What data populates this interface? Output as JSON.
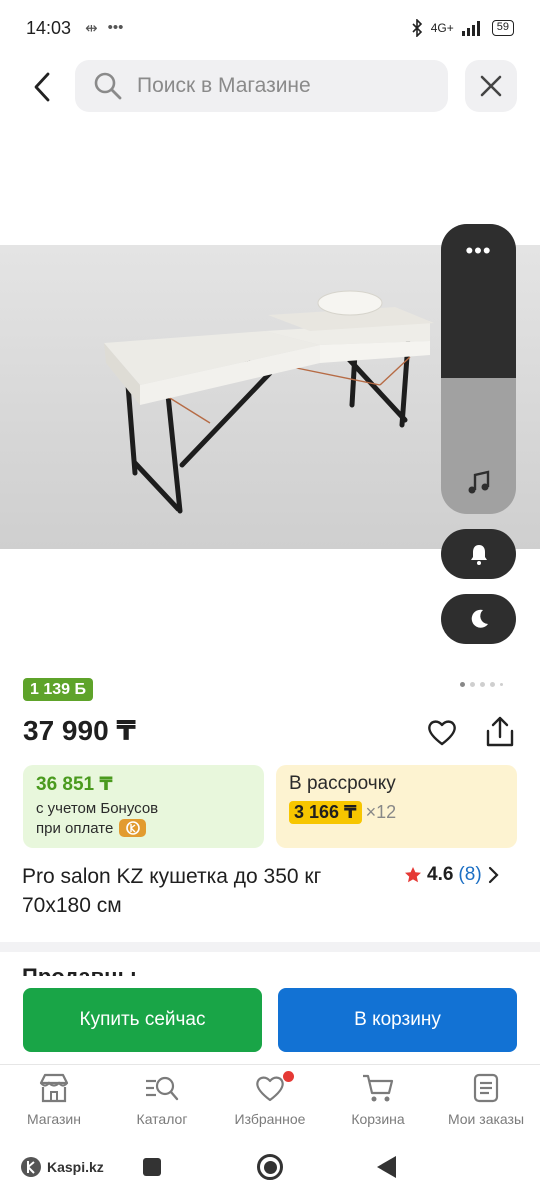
{
  "status": {
    "time": "14:03",
    "network": "4G+",
    "battery": "59"
  },
  "search": {
    "placeholder": "Поиск в Магазине"
  },
  "product": {
    "bonus_badge": "1 139 Б",
    "price": "37 990 ₸",
    "title": "Pro salon KZ кушетка до 350 кг 70x180 см",
    "rating": "4.6",
    "reviews": "(8)"
  },
  "bonus_card": {
    "price": "36 851 ₸",
    "line1": "с учетом Бонусов",
    "line2": "при оплате"
  },
  "credit_card": {
    "label": "В рассрочку",
    "monthly": "3 166 ₸",
    "months": "×12"
  },
  "sellers_heading": "Продавцы",
  "actions": {
    "buy_now": "Купить сейчас",
    "to_cart": "В корзину"
  },
  "nav": [
    {
      "label": "Магазин",
      "icon": "shop-icon"
    },
    {
      "label": "Каталог",
      "icon": "catalog-search-icon"
    },
    {
      "label": "Избранное",
      "icon": "heart-icon"
    },
    {
      "label": "Корзина",
      "icon": "cart-icon"
    },
    {
      "label": "Мои заказы",
      "icon": "orders-icon"
    }
  ],
  "system": {
    "brand": "Kaspi.kz"
  },
  "colors": {
    "green": "#19a547",
    "blue": "#1272d4",
    "badge_green": "#5ea32a",
    "yellow": "#f7c600",
    "accent_red": "#e53935"
  }
}
